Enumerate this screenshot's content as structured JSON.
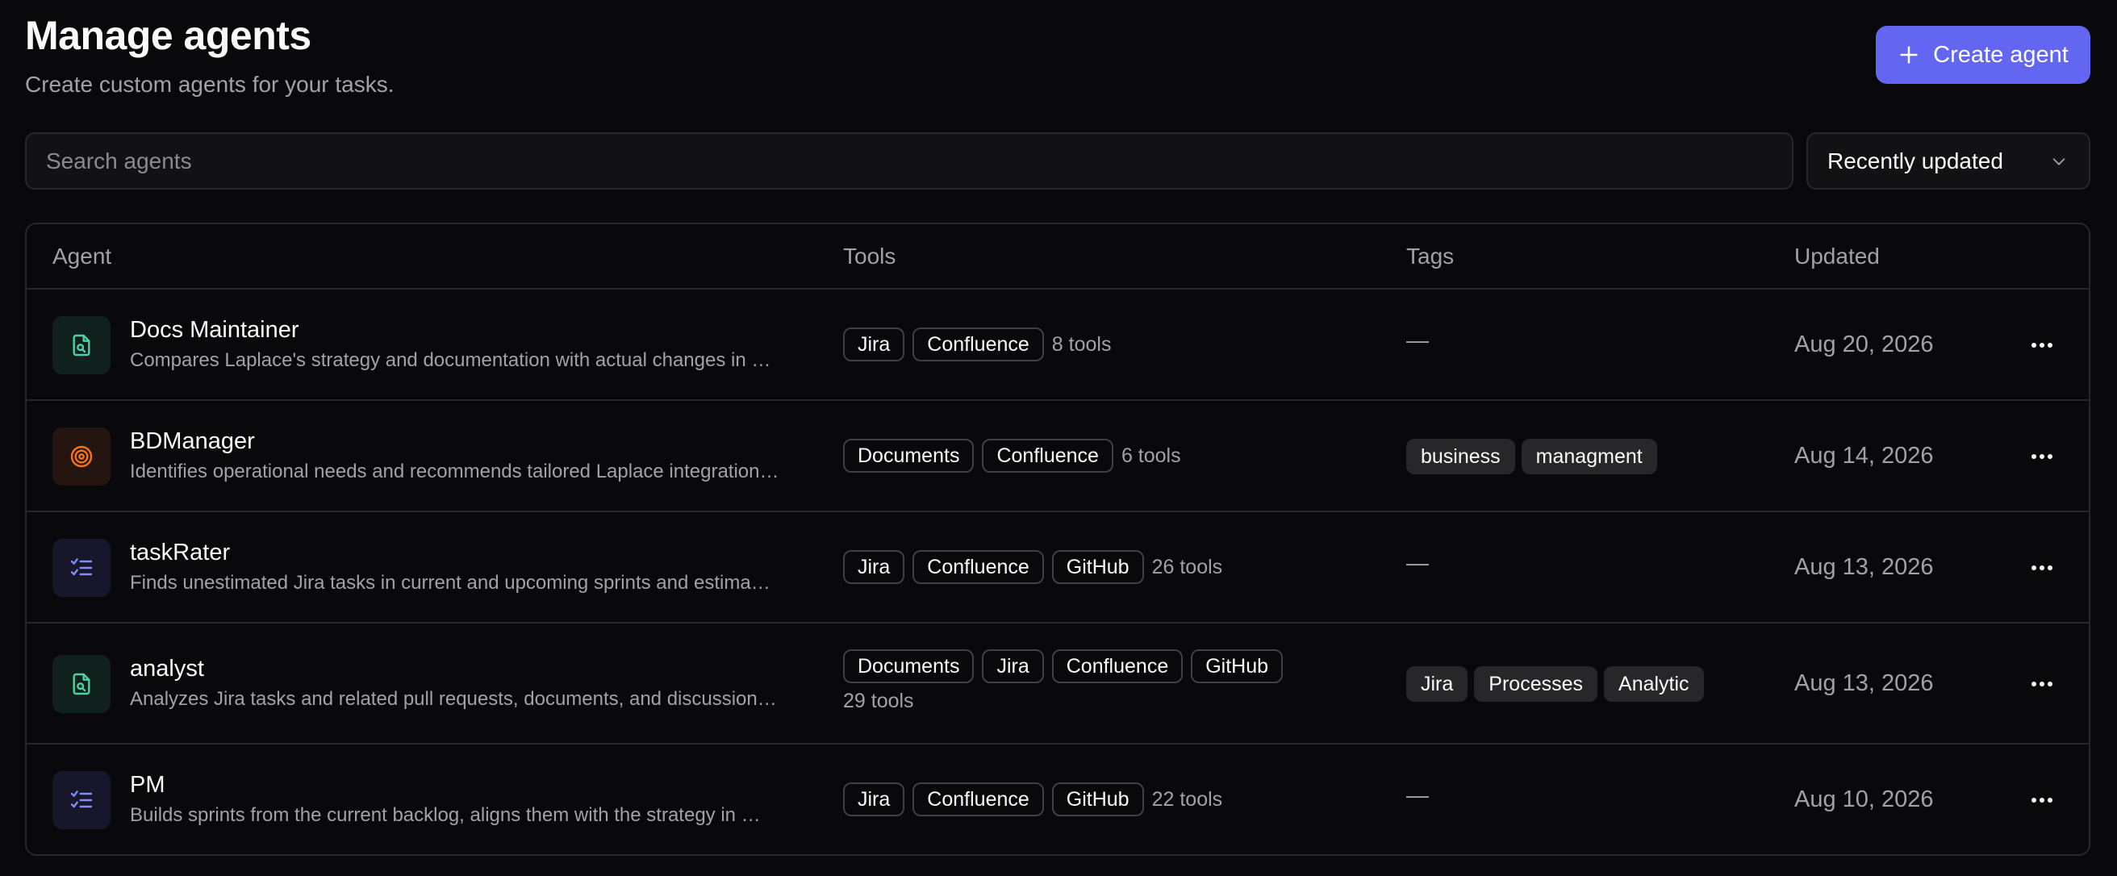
{
  "header": {
    "title": "Manage agents",
    "subtitle": "Create custom agents for your tasks.",
    "create_label": "Create agent"
  },
  "search": {
    "placeholder": "Search agents",
    "value": ""
  },
  "sort": {
    "selected": "Recently updated"
  },
  "table": {
    "columns": [
      "Agent",
      "Tools",
      "Tags",
      "Updated"
    ],
    "rows": [
      {
        "icon": "document-search-icon",
        "name": "Docs Maintainer",
        "description": "Compares Laplace's strategy and documentation with actual changes in …",
        "tools": [
          "Jira",
          "Confluence"
        ],
        "tools_count": "8 tools",
        "tags": [],
        "tags_empty": "—",
        "updated": "Aug 20, 2026"
      },
      {
        "icon": "target-icon",
        "name": "BDManager",
        "description": "Identifies operational needs and recommends tailored Laplace integration…",
        "tools": [
          "Documents",
          "Confluence"
        ],
        "tools_count": "6 tools",
        "tags": [
          "business",
          "managment"
        ],
        "tags_empty": "",
        "updated": "Aug 14, 2026"
      },
      {
        "icon": "checklist-icon",
        "name": "taskRater",
        "description": "Finds unestimated Jira tasks in current and upcoming sprints and estima…",
        "tools": [
          "Jira",
          "Confluence",
          "GitHub"
        ],
        "tools_count": "26 tools",
        "tags": [],
        "tags_empty": "—",
        "updated": "Aug 13, 2026"
      },
      {
        "icon": "document-search-icon",
        "name": "analyst",
        "description": "Analyzes Jira tasks and related pull requests, documents, and discussion…",
        "tools": [
          "Documents",
          "Jira",
          "Confluence",
          "GitHub"
        ],
        "tools_count": "29 tools",
        "tags": [
          "Jira",
          "Processes",
          "Analytic"
        ],
        "tags_empty": "",
        "updated": "Aug 13, 2026"
      },
      {
        "icon": "checklist-icon",
        "name": "PM",
        "description": "Builds sprints from the current backlog, aligns them with the strategy in …",
        "tools": [
          "Jira",
          "Confluence",
          "GitHub"
        ],
        "tools_count": "22 tools",
        "tags": [],
        "tags_empty": "—",
        "updated": "Aug 10, 2026"
      }
    ]
  },
  "colors": {
    "background": "#09090b",
    "accent": "#6366f1",
    "border": "#27272a",
    "muted_text": "#a1a1aa",
    "teal_icon": "#4fd1a5",
    "orange_icon": "#f97316",
    "purple_icon": "#818cf8"
  }
}
